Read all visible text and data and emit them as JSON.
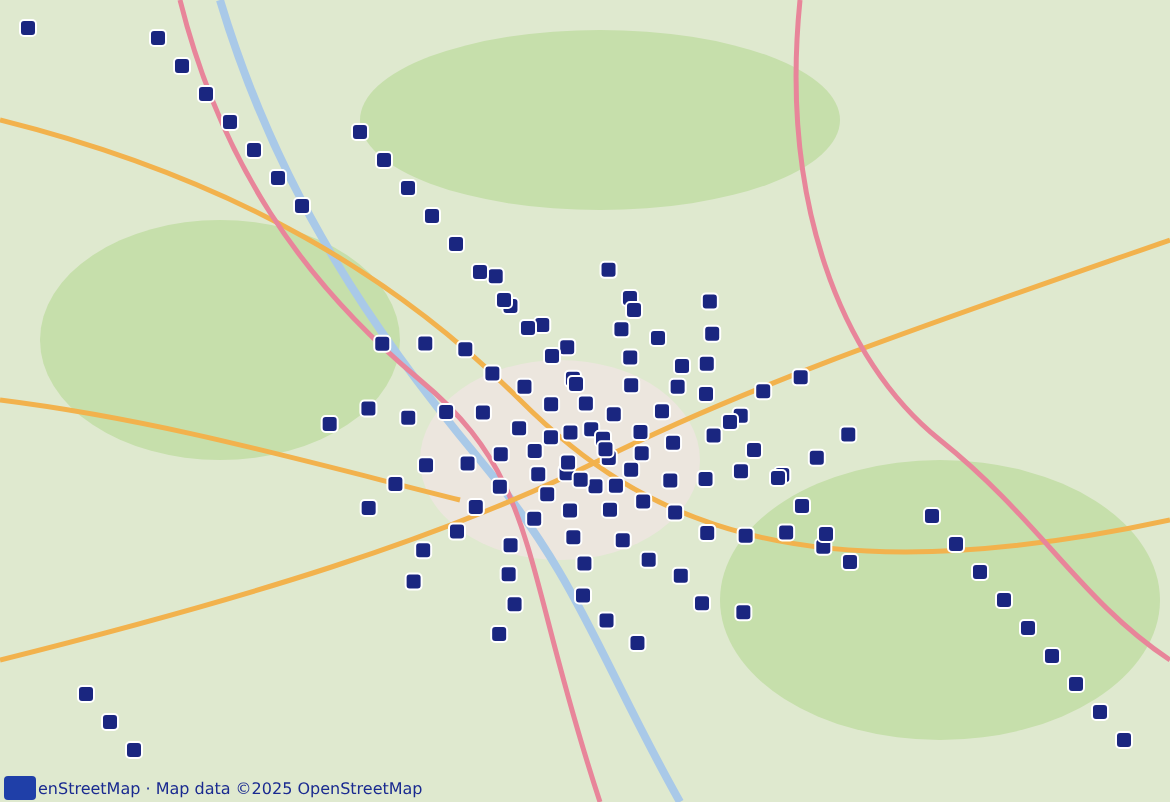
{
  "attribution": {
    "text": "enStreetMap · Map data ©2025 OpenStreetMap"
  }
}
